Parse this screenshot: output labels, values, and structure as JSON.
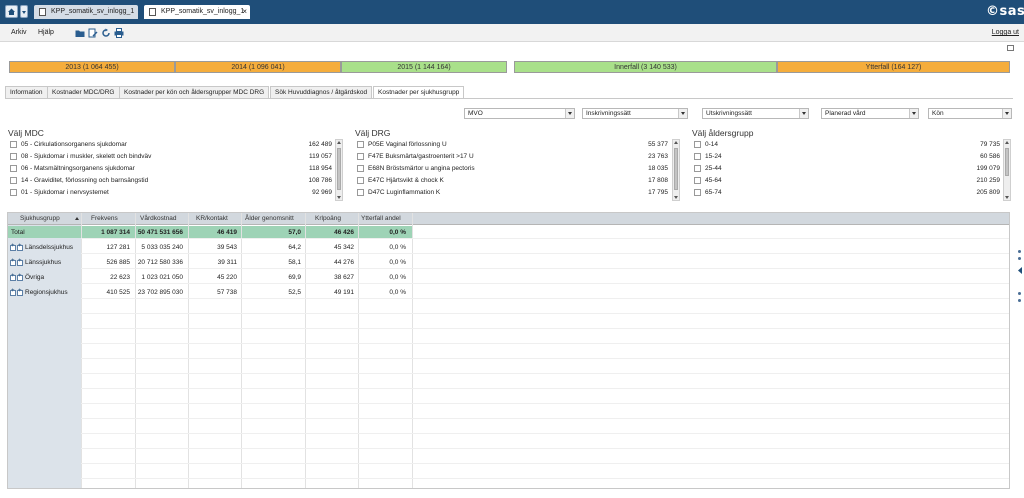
{
  "tabs": [
    {
      "label": "KPP_somatik_sv_inlogg_1",
      "active": false
    },
    {
      "label": "KPP_somatik_sv_inlogg_1",
      "active": true,
      "close": "×"
    }
  ],
  "brand": "©sas",
  "menu": {
    "file": "Arkiv",
    "help": "Hjälp",
    "logout": "Logga ut"
  },
  "toolbar_icons": [
    "folder-open-icon",
    "edit-doc-icon",
    "refresh-icon",
    "print-icon"
  ],
  "year_bars": [
    {
      "label": "2013 (1 064 455)",
      "color": "#f5ad3c"
    },
    {
      "label": "2014 (1 096 041)",
      "color": "#f5ad3c"
    },
    {
      "label": "2015 (1 144 164)",
      "color": "#a9e08a"
    }
  ],
  "case_bars": [
    {
      "label": "Innerfall (3 140 533)",
      "color": "#a9e08a"
    },
    {
      "label": "Ytterfall (164 127)",
      "color": "#f5ad3c"
    }
  ],
  "report_tabs": [
    {
      "label": "Information"
    },
    {
      "label": "Kostnader MDC/DRG"
    },
    {
      "label": "Kostnader per kön och åldersgrupper MDC DRG"
    },
    {
      "label": "Sök Huvuddiagnos / åtgärdskod"
    },
    {
      "label": "Kostnader per sjukhusgrupp",
      "active": true
    }
  ],
  "filters": [
    {
      "value": "MVO"
    },
    {
      "value": "Inskrivningssätt"
    },
    {
      "value": "Utskrivningssätt"
    },
    {
      "value": "Planerad vård"
    },
    {
      "value": "Kön"
    }
  ],
  "mdc": {
    "title": "Välj MDC",
    "items": [
      {
        "label": "05 - Cirkulationsorganens sjukdomar",
        "value": "162 489"
      },
      {
        "label": "08 - Sjukdomar i muskler, skelett och bindväv",
        "value": "119 057"
      },
      {
        "label": "06 - Matsmältningsorganens sjukdomar",
        "value": "118 954"
      },
      {
        "label": "14 - Graviditet, förlossning och barnsängstid",
        "value": "108 786"
      },
      {
        "label": "01 - Sjukdomar i nervsystemet",
        "value": "92 969"
      }
    ]
  },
  "drg": {
    "title": "Välj DRG",
    "items": [
      {
        "label": "P05E Vaginal förlossning U",
        "value": "55 377"
      },
      {
        "label": "F47E Buksmärta/gastroenterit >17 U",
        "value": "23 763"
      },
      {
        "label": "E68N Bröstsmärtor u angina pectoris",
        "value": "18 035"
      },
      {
        "label": "E47C Hjärtsvikt & chock K",
        "value": "17 808"
      },
      {
        "label": "D47C Luginflammation K",
        "value": "17 795"
      }
    ]
  },
  "age": {
    "title": "Välj åldersgrupp",
    "items": [
      {
        "label": "0-14",
        "value": "79 735"
      },
      {
        "label": "15-24",
        "value": "60 586"
      },
      {
        "label": "25-44",
        "value": "199 079"
      },
      {
        "label": "45-64",
        "value": "210 259"
      },
      {
        "label": "65-74",
        "value": "205 809"
      }
    ]
  },
  "table": {
    "columns": [
      "Sjukhusgrupp",
      "Frekvens",
      "Vårdkostnad",
      "KR/kontakt",
      "Ålder genomsnitt",
      "Krlpoäng",
      "Ytterfall andel"
    ],
    "total": {
      "label": "Total",
      "values": [
        "1 087 314",
        "50 471 531 656",
        "46 419",
        "57,0",
        "46 426",
        "0,0 %"
      ]
    },
    "rows": [
      {
        "label": "Länsdelssjukhus",
        "values": [
          "127 281",
          "5 033 035 240",
          "39 543",
          "64,2",
          "45 342",
          "0,0 %"
        ]
      },
      {
        "label": "Länssjukhus",
        "values": [
          "526 885",
          "20 712 580 336",
          "39 311",
          "58,1",
          "44 276",
          "0,0 %"
        ]
      },
      {
        "label": "Övriga",
        "values": [
          "22 623",
          "1 023 021 050",
          "45 220",
          "69,9",
          "38 627",
          "0,0 %"
        ]
      },
      {
        "label": "Regionsjukhus",
        "values": [
          "410 525",
          "23 702 895 030",
          "57 738",
          "52,5",
          "49 191",
          "0,0 %"
        ]
      }
    ]
  },
  "colors": {
    "topbar": "#1f4e79",
    "orange": "#f5ad3c",
    "green": "#a9e08a",
    "total_row": "#9ed3b6"
  }
}
